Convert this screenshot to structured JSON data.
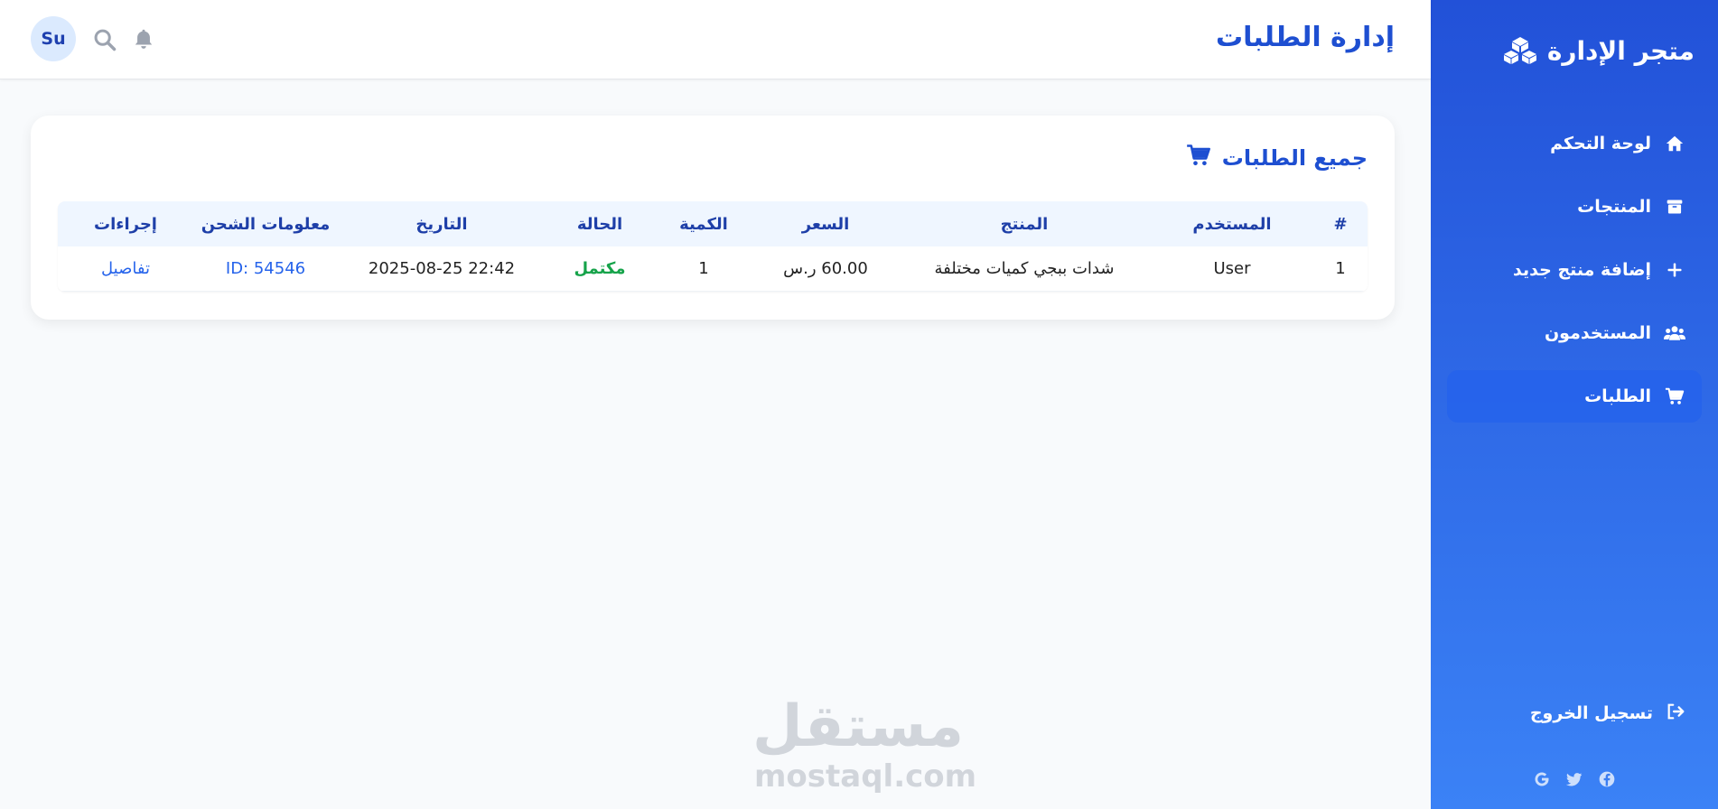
{
  "sidebar": {
    "brand": "متجر الإدارة",
    "items": [
      {
        "label": "لوحة التحكم",
        "icon": "home-icon"
      },
      {
        "label": "المنتجات",
        "icon": "box-icon"
      },
      {
        "label": "إضافة منتج جديد",
        "icon": "plus-icon"
      },
      {
        "label": "المستخدمون",
        "icon": "users-icon"
      },
      {
        "label": "الطلبات",
        "icon": "cart-icon",
        "active": true
      }
    ],
    "logout": "تسجيل الخروج"
  },
  "header": {
    "title": "إدارة الطلبات",
    "avatar": "Su"
  },
  "orders": {
    "title": "جميع الطلبات",
    "columns": [
      "#",
      "المستخدم",
      "المنتج",
      "السعر",
      "الكمية",
      "الحالة",
      "التاريخ",
      "معلومات الشحن",
      "إجراءات"
    ],
    "rows": [
      {
        "id": "1",
        "user": "User",
        "product": "شدات ببجي كميات مختلفة",
        "price": "60.00 ر.س",
        "quantity": "1",
        "status": "مكتمل",
        "date": "2025-08-25 22:42",
        "shipping": "ID: 54546",
        "action": "تفاصيل"
      }
    ]
  },
  "watermark": {
    "arabic": "مستقل",
    "latin": "mostaql.com"
  },
  "colors": {
    "accent": "#1e4fd1",
    "sidebar_top": "#2251d8",
    "sidebar_bottom": "#3b82f6",
    "success": "#16a34a"
  }
}
